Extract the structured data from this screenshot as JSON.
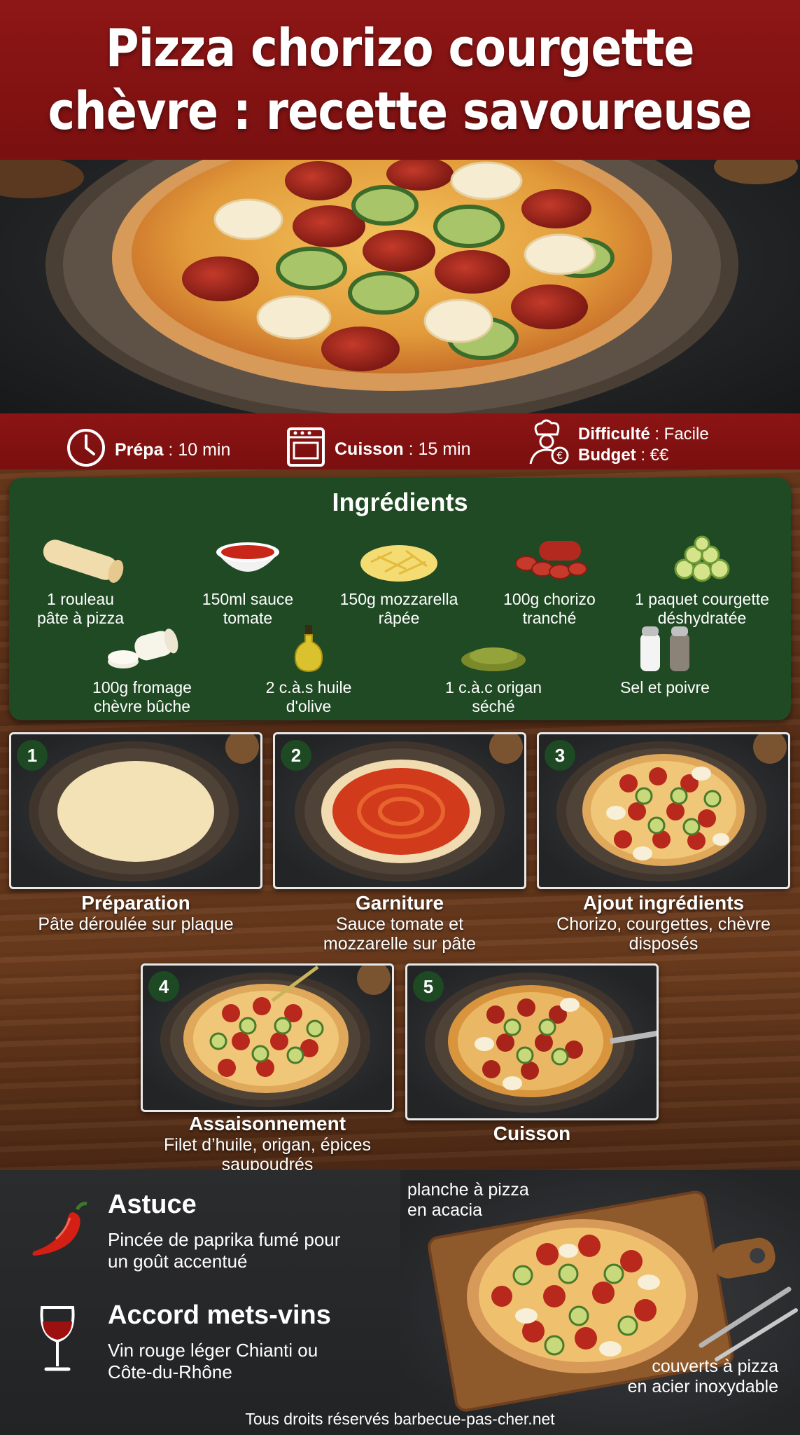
{
  "title": {
    "line1": "Pizza chorizo courgette",
    "line2": "chèvre : recette savoureuse"
  },
  "info": {
    "prep_label": "Prépa",
    "prep_value": " : 10 min",
    "cook_label": "Cuisson",
    "cook_value": " : 15 min",
    "difficulty_label": "Difficulté",
    "difficulty_value": " : Facile",
    "budget_label": "Budget",
    "budget_value": " : €€"
  },
  "ingredients": {
    "title": "Ingrédients",
    "items": [
      {
        "l1": "1 rouleau",
        "l2": "pâte à pizza",
        "icon": "dough-roll-icon"
      },
      {
        "l1": "150ml sauce",
        "l2": "tomate",
        "icon": "tomato-sauce-bowl-icon"
      },
      {
        "l1": "150g mozzarella",
        "l2": "râpée",
        "icon": "grated-cheese-icon"
      },
      {
        "l1": "100g chorizo",
        "l2": "tranché",
        "icon": "chorizo-icon"
      },
      {
        "l1": "1 paquet courgette",
        "l2": "déshydratée",
        "icon": "zucchini-icon"
      },
      {
        "l1": "100g fromage",
        "l2": "chèvre bûche",
        "icon": "goat-cheese-icon"
      },
      {
        "l1": "2 c.à.s huile",
        "l2": "d'olive",
        "icon": "olive-oil-icon"
      },
      {
        "l1": "1 c.à.c origan",
        "l2": "séché",
        "icon": "oregano-icon"
      },
      {
        "l1": "Sel et poivre",
        "l2": "",
        "icon": "salt-pepper-icon"
      }
    ]
  },
  "steps": [
    {
      "num": "1",
      "title": "Préparation",
      "l1": "Pâte déroulée sur plaque",
      "l2": ""
    },
    {
      "num": "2",
      "title": "Garniture",
      "l1": "Sauce tomate et",
      "l2": "mozzarelle sur pâte"
    },
    {
      "num": "3",
      "title": "Ajout ingrédients",
      "l1": "Chorizo, courgettes, chèvre",
      "l2": "disposés"
    },
    {
      "num": "4",
      "title": "Assaisonnement",
      "l1": "Filet d’huile, origan, épices",
      "l2": "saupoudrés"
    },
    {
      "num": "5",
      "title": "Cuisson",
      "l1": "",
      "l2": ""
    }
  ],
  "tip": {
    "title": "Astuce",
    "l1": "Pincée de paprika fumé pour",
    "l2": "un goût accentué"
  },
  "wine": {
    "title": "Accord mets-vins",
    "l1": "Vin rouge léger Chianti ou",
    "l2": "Côte-du-Rhône"
  },
  "callouts": {
    "board_l1": "planche à pizza",
    "board_l2": "en acacia",
    "cutlery_l1": "couverts à pizza",
    "cutlery_l2": "en acier inoxydable"
  },
  "footer": "Tous droits réservés barbecue-pas-cher.net",
  "colors": {
    "header_red": "#8e1616",
    "ingredient_green": "#1f4a23",
    "wood": "#6b3a1c"
  }
}
